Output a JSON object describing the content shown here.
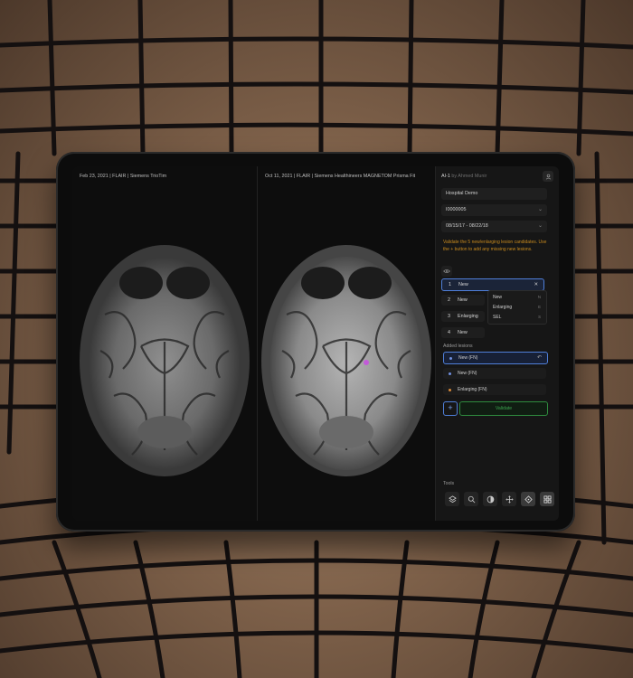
{
  "left_viewer": {
    "label": "Feb 23, 2021 | FLAIR | Siemens TrioTim"
  },
  "right_viewer": {
    "label": "Oct 11, 2021 | FLAIR | Siemens Healthineers MAGNETOM Prisma Fit"
  },
  "panel": {
    "app_name": "AI-1",
    "app_sub": " by Ahmed Munir",
    "user_icon": "user-icon",
    "hospital": "Hospital Demo",
    "patient_id": "I0000005",
    "date_range": "08/15/17  -  08/22/18",
    "instructions": "Validate the 5 new/enlarging lesion candidates. Use the + button to add any missing new lesions.",
    "eye_icon": "eye-icon",
    "lesions": [
      {
        "num": "1",
        "label": "New"
      },
      {
        "num": "2",
        "label": "New"
      },
      {
        "num": "3",
        "label": "Enlarging"
      },
      {
        "num": "4",
        "label": "New"
      }
    ],
    "dropdown_options": [
      {
        "label": "New",
        "key": "N"
      },
      {
        "label": "Enlarging",
        "key": "E"
      },
      {
        "label": "SEL",
        "key": "S"
      }
    ],
    "added_title": "Added lesions",
    "added": [
      {
        "label": "New (FN)",
        "color": "#6f8fe0"
      },
      {
        "label": "New (FN)",
        "color": "#6f8fe0"
      },
      {
        "label": "Enlarging (FN)",
        "color": "#d98a3a"
      }
    ],
    "validate_label": "Validate",
    "add_label": "+",
    "tools_title": "Tools",
    "tools": [
      "layers-icon",
      "zoom-icon",
      "contrast-icon",
      "pan-icon",
      "crosshair-icon",
      "grid-icon"
    ]
  }
}
